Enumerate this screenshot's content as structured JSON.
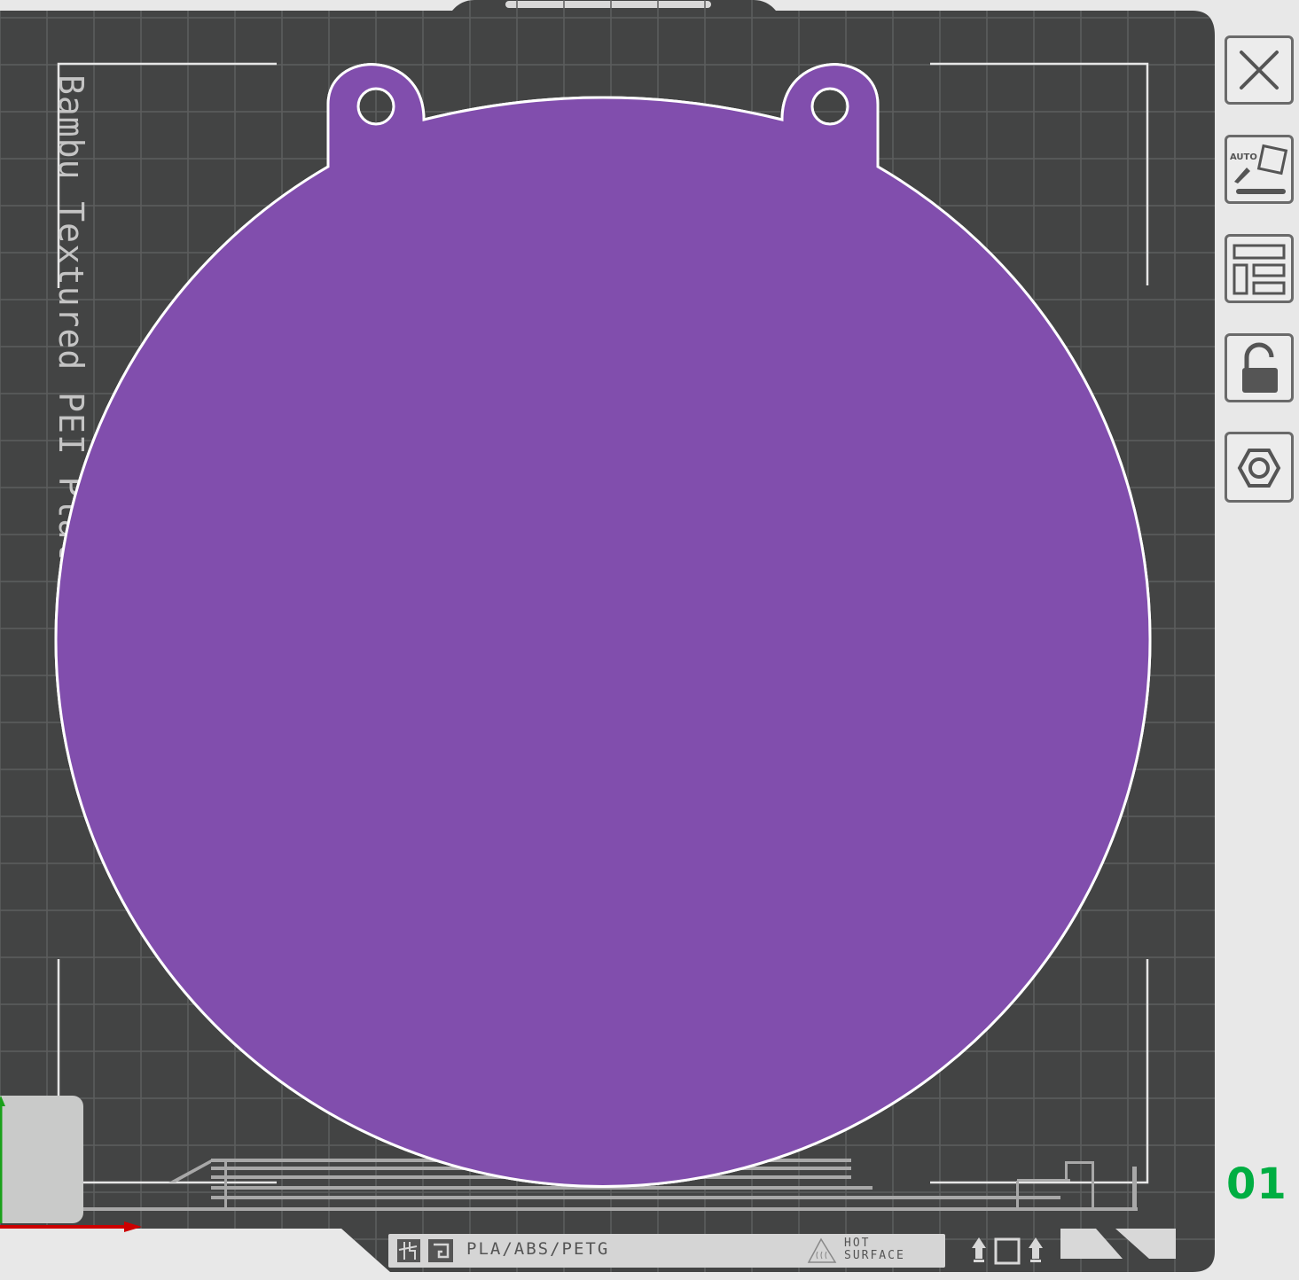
{
  "plate": {
    "bed_label": "Bambu Textured PEI Plate",
    "filament_label": "PLA/ABS/PETG",
    "hot_surface_line1": "HOT",
    "hot_surface_line2": "SURFACE",
    "number": "01"
  },
  "object": {
    "color": "#814ead",
    "outline_color": "#ffffff"
  },
  "colors": {
    "bed": "#434444",
    "grid": "#5b5c5c",
    "panel_bg": "#e8e8e8",
    "plate_number": "#00ae42",
    "x_axis": "#cc0000",
    "y_axis": "#1aa01a"
  },
  "toolbar": {
    "buttons": [
      {
        "name": "close-plate-button",
        "icon": "close-icon"
      },
      {
        "name": "auto-orient-button",
        "icon": "auto-orient-icon"
      },
      {
        "name": "arrange-button",
        "icon": "arrange-icon"
      },
      {
        "name": "lock-plate-button",
        "icon": "unlock-icon"
      },
      {
        "name": "plate-settings-button",
        "icon": "settings-hex-icon"
      }
    ]
  }
}
